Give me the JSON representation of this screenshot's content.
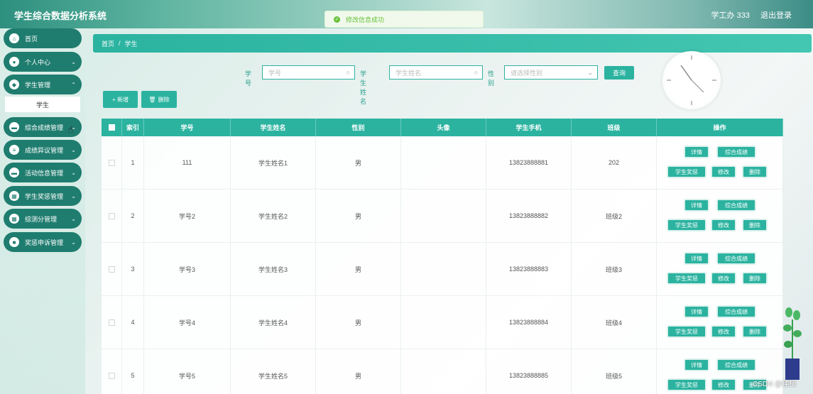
{
  "app": {
    "title": "学生综合数据分析系统"
  },
  "user": {
    "name": "学工办 333",
    "logout": "退出登录"
  },
  "toast": {
    "text": "修改信息成功"
  },
  "sidebar": {
    "items": [
      {
        "label": "首页",
        "icon": "home-icon",
        "has_chevron": false
      },
      {
        "label": "个人中心",
        "icon": "user-icon",
        "has_chevron": true
      },
      {
        "label": "学生管理",
        "icon": "location-icon",
        "has_chevron": true
      },
      {
        "label": "综合成绩管理",
        "icon": "doc-icon",
        "has_chevron": true
      },
      {
        "label": "成绩异议管理",
        "icon": "list-icon",
        "has_chevron": true
      },
      {
        "label": "活动信息管理",
        "icon": "doc-icon",
        "has_chevron": true
      },
      {
        "label": "学生奖惩管理",
        "icon": "grid-icon",
        "has_chevron": true
      },
      {
        "label": "综测分管理",
        "icon": "grid-icon",
        "has_chevron": true
      },
      {
        "label": "奖惩申诉管理",
        "icon": "box-icon",
        "has_chevron": true
      }
    ],
    "sub_item": "学生"
  },
  "breadcrumb": {
    "home": "首页",
    "separator": "/",
    "current": "学生"
  },
  "search": {
    "fields": [
      {
        "label": "学号",
        "placeholder": "学号"
      },
      {
        "label": "学生姓名",
        "placeholder": "学生姓名"
      },
      {
        "label": "性别",
        "placeholder": "请选择性别"
      }
    ],
    "query_label": "查询"
  },
  "actions": {
    "add_label": "+ 新增",
    "delete_label": "删除"
  },
  "table": {
    "columns": [
      "索引",
      "学号",
      "学生姓名",
      "性别",
      "头像",
      "学生手机",
      "班级",
      "操作"
    ],
    "rows": [
      {
        "index": "1",
        "student_no": "111",
        "name": "学生姓名1",
        "gender": "男",
        "phone": "13823888881",
        "class": "202"
      },
      {
        "index": "2",
        "student_no": "学号2",
        "name": "学生姓名2",
        "gender": "男",
        "phone": "13823888882",
        "class": "班级2"
      },
      {
        "index": "3",
        "student_no": "学号3",
        "name": "学生姓名3",
        "gender": "男",
        "phone": "13823888883",
        "class": "班级3"
      },
      {
        "index": "4",
        "student_no": "学号4",
        "name": "学生姓名4",
        "gender": "男",
        "phone": "13823888884",
        "class": "班级4"
      },
      {
        "index": "5",
        "student_no": "学号5",
        "name": "学生姓名5",
        "gender": "男",
        "phone": "13823888885",
        "class": "班级5"
      }
    ],
    "row_buttons": {
      "detail": "详情",
      "score": "综合成绩",
      "reward": "学生奖惩",
      "edit": "修改",
      "delete": "删除"
    }
  },
  "watermark": "CSDN @佳楠",
  "colors": {
    "primary": "#2bb3a0",
    "sidebar": "#1f7d6f",
    "success": "#67c23a"
  }
}
